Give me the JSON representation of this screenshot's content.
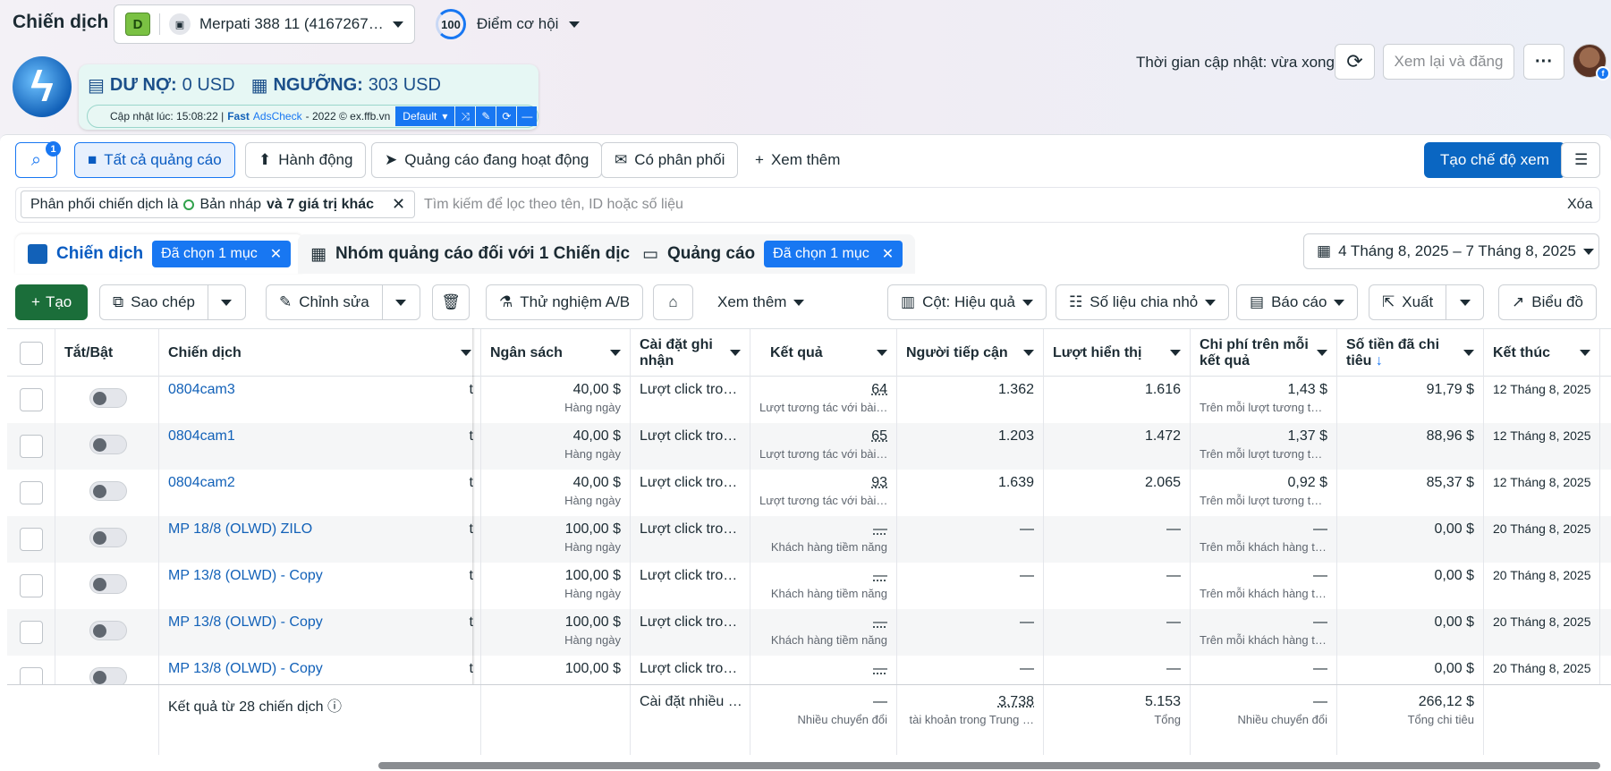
{
  "header": {
    "title": "Chiến dịch",
    "account_letter": "D",
    "account_name": "Merpati 388 11 (4167267…",
    "score_value": "100",
    "score_label": "Điểm cơ hội",
    "update_text": "Thời gian cập nhật: vừa xong",
    "review_label": "Xem lại và đăng",
    "more_label": "···"
  },
  "extension": {
    "debt_label": "DƯ NỢ:",
    "debt_value": "0 USD",
    "threshold_label": "NGƯỠNG:",
    "threshold_value": "303 USD",
    "updated": "Cập nhật lúc: 15:08:22 |",
    "fast": "Fast",
    "adscheck": "AdsCheck",
    "copyright": "- 2022 © ex.ffb.vn",
    "mode": "Default"
  },
  "filters": {
    "search_badge": "1",
    "all_ads": "Tất cả quảng cáo",
    "actions": "Hành động",
    "active_ads": "Quảng cáo đang hoạt động",
    "delivery": "Có phân phối",
    "see_more": "Xem thêm",
    "create_view": "Tạo chế độ xem",
    "chip_text": "Phân phối chiến dịch là",
    "chip_value": "Bản nháp",
    "chip_more": "và 7 giá trị khác",
    "search_placeholder": "Tìm kiếm để lọc theo tên, ID hoặc số liệu",
    "clear": "Xóa"
  },
  "level_tabs": {
    "campaign": "Chiến dịch",
    "campaign_selected": "Đã chọn 1 mục",
    "adset": "Nhóm quảng cáo đối với 1 Chiến dịch",
    "ads": "Quảng cáo",
    "ads_selected": "Đã chọn 1 mục",
    "date_range": "4 Tháng 8, 2025 – 7 Tháng 8, 2025"
  },
  "toolbar": {
    "create": "Tạo",
    "duplicate": "Sao chép",
    "edit": "Chỉnh sửa",
    "ab_test": "Thử nghiệm A/B",
    "see_more": "Xem thêm",
    "columns": "Cột: Hiệu quả",
    "breakdown": "Số liệu chia nhỏ",
    "reports": "Báo cáo",
    "export": "Xuất",
    "chart": "Biểu đồ"
  },
  "table": {
    "headers": {
      "toggle": "Tắt/Bật",
      "campaign": "Chiến dịch",
      "budget": "Ngân sách",
      "attribution": "Cài đặt ghi nhận",
      "results": "Kết quả",
      "reach": "Người tiếp cận",
      "impressions": "Lượt hiển thị",
      "cost_per_result": "Chi phí trên mỗi kết quả",
      "amount_spent": "Số tiền đã chi tiêu",
      "ends": "Kết thúc"
    },
    "rows": [
      {
        "name": "0804cam3",
        "budget": "40,00 $",
        "budget_sub": "Hàng ngày",
        "attribution": "Lượt click tro…",
        "results": "64",
        "results_sub": "Lượt tương tác với bài…",
        "reach": "1.362",
        "impressions": "1.616",
        "cpr": "1,43 $",
        "cpr_sub": "Trên mỗi lượt tương t…",
        "spent": "91,79 $",
        "ends": "12 Tháng 8, 2025"
      },
      {
        "name": "0804cam1",
        "budget": "40,00 $",
        "budget_sub": "Hàng ngày",
        "attribution": "Lượt click tro…",
        "results": "65",
        "results_sub": "Lượt tương tác với bài…",
        "reach": "1.203",
        "impressions": "1.472",
        "cpr": "1,37 $",
        "cpr_sub": "Trên mỗi lượt tương t…",
        "spent": "88,96 $",
        "ends": "12 Tháng 8, 2025"
      },
      {
        "name": "0804cam2",
        "budget": "40,00 $",
        "budget_sub": "Hàng ngày",
        "attribution": "Lượt click tro…",
        "results": "93",
        "results_sub": "Lượt tương tác với bài…",
        "reach": "1.639",
        "impressions": "2.065",
        "cpr": "0,92 $",
        "cpr_sub": "Trên mỗi lượt tương t…",
        "spent": "85,37 $",
        "ends": "12 Tháng 8, 2025"
      },
      {
        "name": "MP 18/8 (OLWD) ZILO",
        "budget": "100,00 $",
        "budget_sub": "Hàng ngày",
        "attribution": "Lượt click tro…",
        "results": "—",
        "results_sub": "Khách hàng tiềm năng",
        "reach": "—",
        "impressions": "—",
        "cpr": "—",
        "cpr_sub": "Trên mỗi khách hàng t…",
        "spent": "0,00 $",
        "ends": "20 Tháng 8, 2025"
      },
      {
        "name": "MP 13/8 (OLWD) - Copy",
        "budget": "100,00 $",
        "budget_sub": "Hàng ngày",
        "attribution": "Lượt click tro…",
        "results": "—",
        "results_sub": "Khách hàng tiềm năng",
        "reach": "—",
        "impressions": "—",
        "cpr": "—",
        "cpr_sub": "Trên mỗi khách hàng t…",
        "spent": "0,00 $",
        "ends": "20 Tháng 8, 2025"
      },
      {
        "name": "MP 13/8 (OLWD) - Copy",
        "budget": "100,00 $",
        "budget_sub": "Hàng ngày",
        "attribution": "Lượt click tro…",
        "results": "—",
        "results_sub": "Khách hàng tiềm năng",
        "reach": "—",
        "impressions": "—",
        "cpr": "—",
        "cpr_sub": "Trên mỗi khách hàng t…",
        "spent": "0,00 $",
        "ends": "20 Tháng 8, 2025"
      },
      {
        "name": "MP 13/8 (OLWD) - Copy",
        "budget": "100,00 $",
        "budget_sub": "",
        "attribution": "Lượt click tro…",
        "results": "—",
        "results_sub": "",
        "reach": "—",
        "impressions": "—",
        "cpr": "—",
        "cpr_sub": "",
        "spent": "0,00 $",
        "ends": "20 Tháng 8, 2025"
      }
    ],
    "hidden_col_fragment": "t",
    "footer": {
      "label": "Kết quả từ 28 chiến dịch",
      "attribution": "Cài đặt nhiều …",
      "results": "—",
      "results_sub": "Nhiều chuyển đổi",
      "reach": "3.738",
      "reach_sub": "tài khoản trong Trung …",
      "impressions": "5.153",
      "impressions_sub": "Tổng",
      "cpr": "—",
      "cpr_sub": "Nhiều chuyển đổi",
      "spent": "266,12 $",
      "spent_sub": "Tổng chi tiêu"
    }
  }
}
